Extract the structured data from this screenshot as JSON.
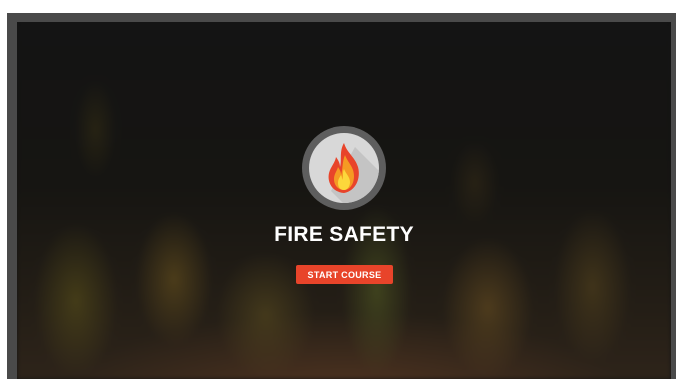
{
  "course": {
    "title": "FIRE SAFETY",
    "start_label": "START COURSE"
  },
  "colors": {
    "accent": "#e8442a",
    "frame": "#4a4a4a",
    "badge_ring": "#5e5e5e",
    "badge_fill": "#d8d8d8",
    "flame_outer": "#e8442a",
    "flame_mid": "#f59a23",
    "flame_inner": "#fcd73b"
  },
  "icons": {
    "badge": "fire-icon"
  }
}
